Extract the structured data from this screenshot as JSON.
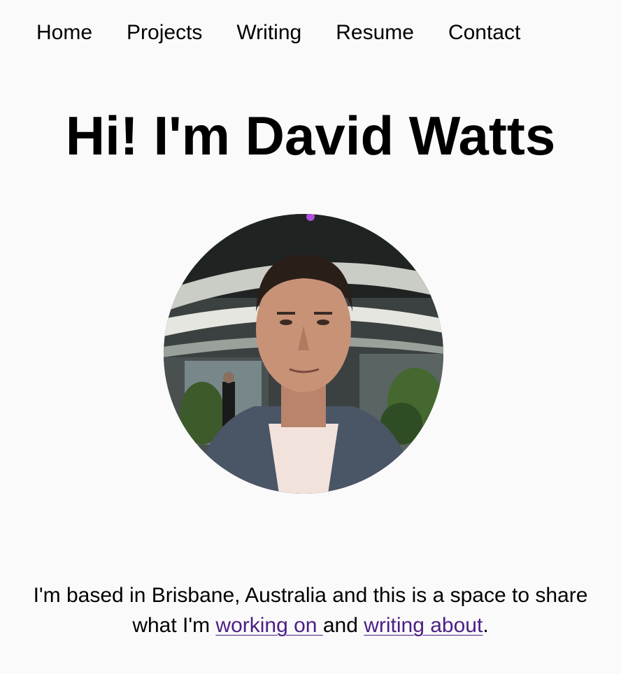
{
  "nav": {
    "items": [
      {
        "label": "Home"
      },
      {
        "label": "Projects"
      },
      {
        "label": "Writing"
      },
      {
        "label": "Resume"
      },
      {
        "label": "Contact"
      }
    ]
  },
  "hero": {
    "title": "Hi! I'm David Watts"
  },
  "intro": {
    "text_before": "I'm based in Brisbane, Australia and this is a space to share what I'm ",
    "link_working": "working on ",
    "text_middle": "and ",
    "link_writing": "writing about",
    "text_after": "."
  },
  "colors": {
    "background": "#fafafa",
    "text": "#000000",
    "link": "#4b1f86"
  }
}
